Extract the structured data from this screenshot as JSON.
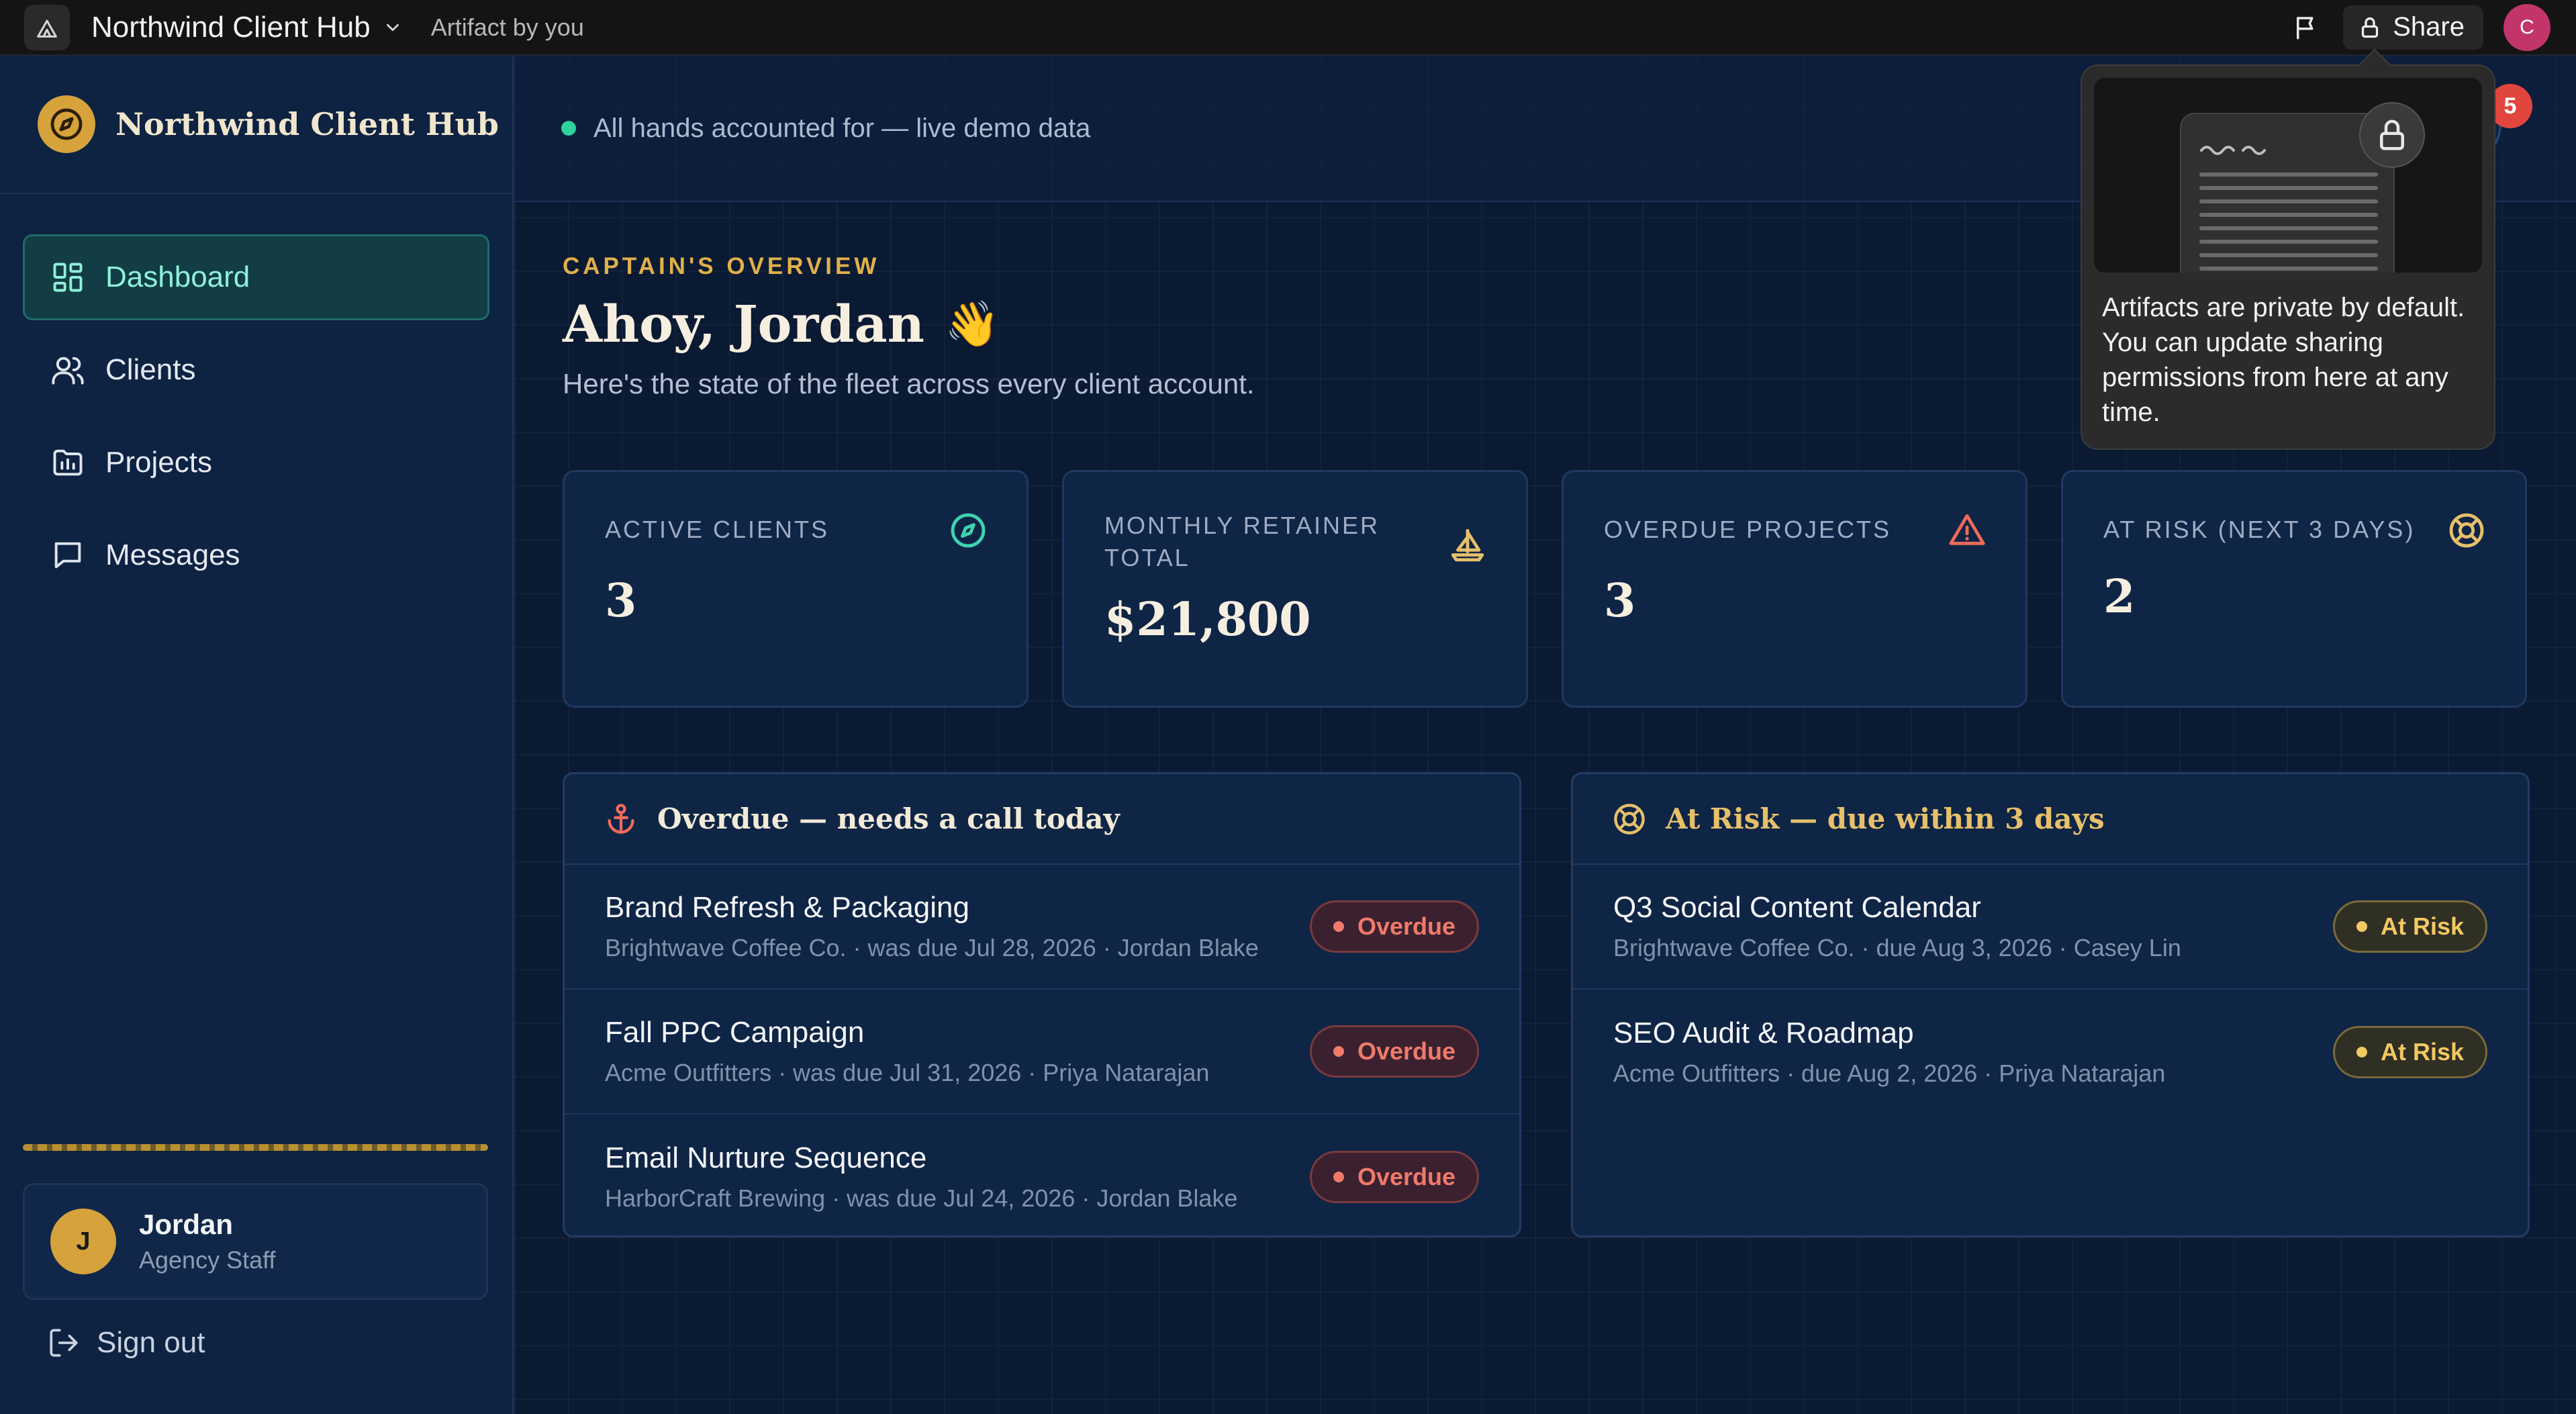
{
  "topbar": {
    "app_title": "Northwind Client Hub",
    "artifact_label": "Artifact by you",
    "share_label": "Share",
    "user_initial": "C"
  },
  "sidebar": {
    "brand_name": "Northwind Client Hub",
    "items": [
      {
        "label": "Dashboard",
        "icon": "dashboard-icon",
        "active": true
      },
      {
        "label": "Clients",
        "icon": "users-icon",
        "active": false
      },
      {
        "label": "Projects",
        "icon": "projects-icon",
        "active": false
      },
      {
        "label": "Messages",
        "icon": "message-icon",
        "active": false
      }
    ],
    "profile": {
      "initial": "J",
      "name": "Jordan",
      "role": "Agency Staff"
    },
    "sign_out": "Sign out"
  },
  "status": {
    "text": "All hands accounted for — live demo data"
  },
  "overview": {
    "eyebrow": "CAPTAIN'S OVERVIEW",
    "greeting": "Ahoy, Jordan",
    "wave": "👋",
    "subtitle": "Here's the state of the fleet across every client account."
  },
  "stats": [
    {
      "label": "ACTIVE CLIENTS",
      "value": "3",
      "icon": "compass-icon",
      "color": "#3fd3b0"
    },
    {
      "label": "MONTHLY RETAINER TOTAL",
      "value": "$21,800",
      "icon": "sailboat-icon",
      "color": "#e6c06a"
    },
    {
      "label": "OVERDUE PROJECTS",
      "value": "3",
      "icon": "warning-icon",
      "color": "#ef6a5a"
    },
    {
      "label": "AT RISK (NEXT 3 DAYS)",
      "value": "2",
      "icon": "lifebuoy-icon",
      "color": "#e6c06a"
    }
  ],
  "overdue_panel": {
    "title": "Overdue — needs a call today",
    "items": [
      {
        "title": "Brand Refresh & Packaging",
        "meta": "Brightwave Coffee Co. · was due Jul 28, 2026 · Jordan Blake",
        "badge": "Overdue"
      },
      {
        "title": "Fall PPC Campaign",
        "meta": "Acme Outfitters · was due Jul 31, 2026 · Priya Natarajan",
        "badge": "Overdue"
      },
      {
        "title": "Email Nurture Sequence",
        "meta": "HarborCraft Brewing · was due Jul 24, 2026 · Jordan Blake",
        "badge": "Overdue"
      }
    ]
  },
  "risk_panel": {
    "title": "At Risk — due within 3 days",
    "items": [
      {
        "title": "Q3 Social Content Calendar",
        "meta": "Brightwave Coffee Co. · due Aug 3, 2026 · Casey Lin",
        "badge": "At Risk"
      },
      {
        "title": "SEO Audit & Roadmap",
        "meta": "Acme Outfitters · due Aug 2, 2026 · Priya Natarajan",
        "badge": "At Risk"
      }
    ]
  },
  "notifications": {
    "count": "5"
  },
  "tooltip": {
    "text": "Artifacts are private by default. You can update sharing permissions from here at any time."
  }
}
